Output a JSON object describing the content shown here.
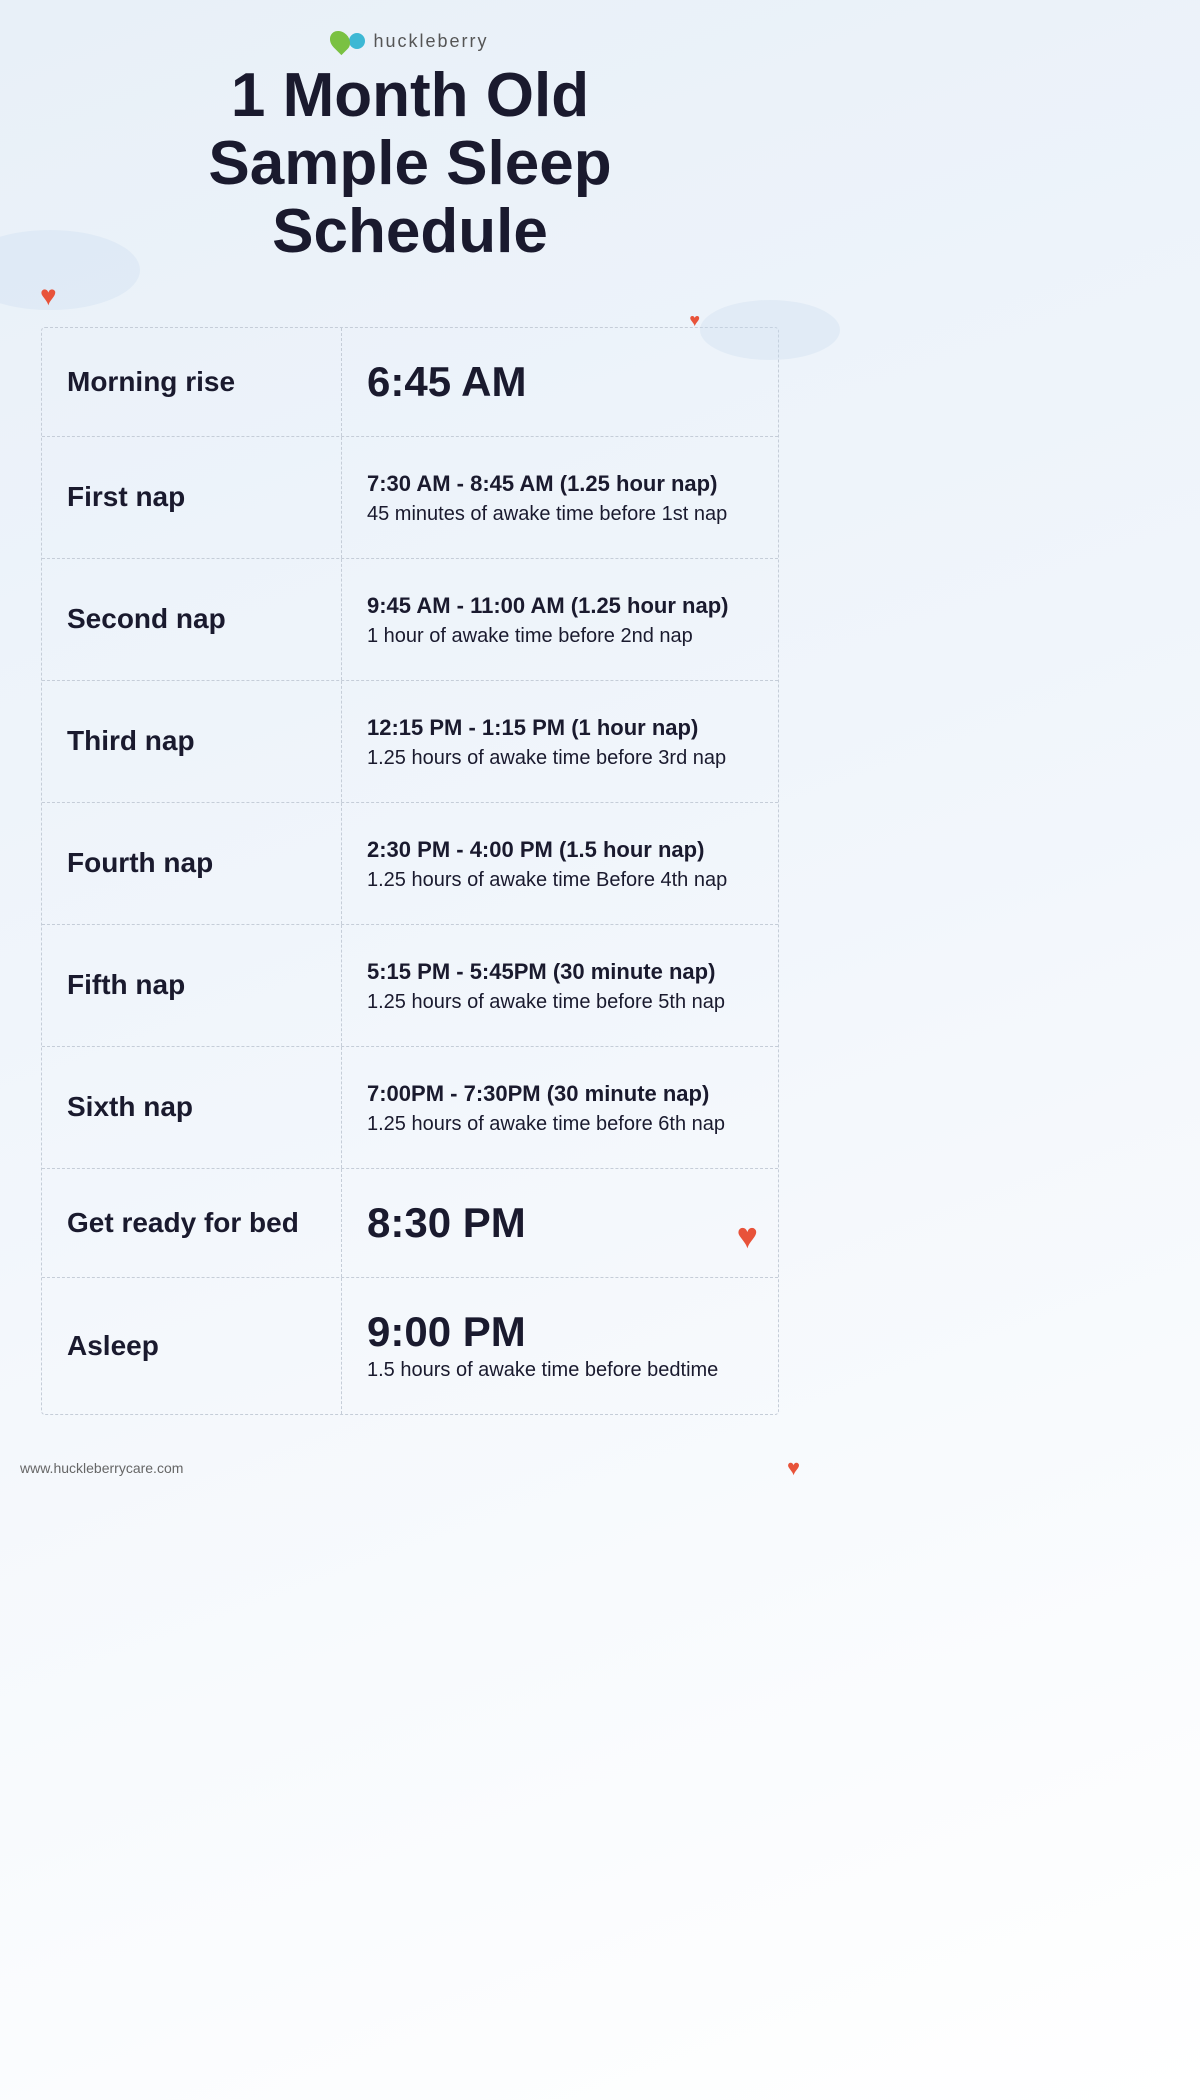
{
  "logo": {
    "text": "huckleberry"
  },
  "header": {
    "title_line1": "1 Month Old",
    "title_line2": "Sample Sleep",
    "title_line3": "Schedule"
  },
  "rows": [
    {
      "label": "Morning rise",
      "value_large": "6:45 AM",
      "value_sub": ""
    },
    {
      "label": "First nap",
      "value_large": "",
      "value_main": "7:30 AM - 8:45 AM (1.25 hour nap)",
      "value_sub": "45 minutes of awake time before 1st nap"
    },
    {
      "label": "Second nap",
      "value_large": "",
      "value_main": "9:45 AM - 11:00 AM (1.25 hour nap)",
      "value_sub": "1 hour of awake time before 2nd nap"
    },
    {
      "label": "Third nap",
      "value_large": "",
      "value_main": "12:15 PM - 1:15 PM (1 hour nap)",
      "value_sub": "1.25 hours of awake time before 3rd nap"
    },
    {
      "label": "Fourth nap",
      "value_large": "",
      "value_main": "2:30 PM - 4:00 PM (1.5 hour nap)",
      "value_sub": "1.25 hours of awake time Before 4th nap"
    },
    {
      "label": "Fifth nap",
      "value_large": "",
      "value_main": "5:15 PM - 5:45PM (30 minute nap)",
      "value_sub": "1.25 hours of awake time before 5th nap"
    },
    {
      "label": "Sixth nap",
      "value_large": "",
      "value_main": "7:00PM - 7:30PM (30 minute nap)",
      "value_sub": "1.25 hours of awake time before 6th nap"
    },
    {
      "label": "Get ready for bed",
      "value_large": "8:30 PM",
      "value_sub": "",
      "has_heart": true
    },
    {
      "label": "Asleep",
      "value_large": "9:00 PM",
      "value_sub": "1.5 hours of awake time before bedtime"
    }
  ],
  "footer": {
    "url": "www.huckleberrycare.com"
  }
}
